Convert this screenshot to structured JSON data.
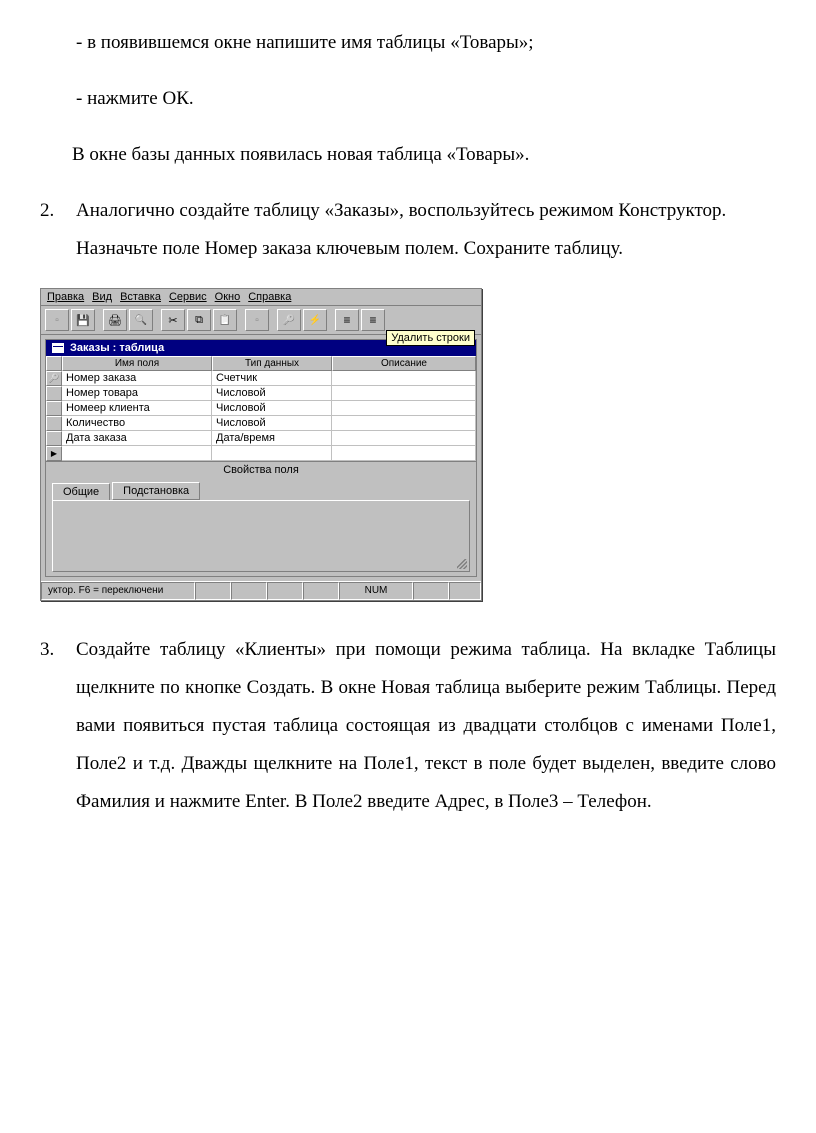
{
  "text": {
    "bullet1": "- в появившемся окне напишите имя таблицы «Товары»;",
    "bullet2": "- нажмите ОК.",
    "para_db": "В окне базы данных появилась новая таблица «Товары».",
    "item2_num": "2.",
    "item2_body": "Аналогично создайте таблицу «Заказы», воспользуйтесь режимом Конструктор.",
    "item2_body2": "Назначьте поле Номер заказа ключевым полем. Сохраните таблицу.",
    "item3_num": "3.",
    "item3_body": "Создайте таблицу «Клиенты» при помощи режима таблица. На вкладке Таблицы щелкните по кнопке Создать. В окне Новая таблица выберите режим Таблицы. Перед вами появиться пустая таблица состоящая из двадцати столбцов с именами Поле1, Поле2 и т.д. Дважды щелкните на Поле1, текст в поле будет выделен, введите слово Фамилия и нажмите Enter. В Поле2 введите Адрес, в Поле3 – Телефон."
  },
  "access": {
    "menu": [
      "Правка",
      "Вид",
      "Вставка",
      "Сервис",
      "Окно",
      "Справка"
    ],
    "tooltip": "Удалить строки",
    "window_title": "Заказы : таблица",
    "grid_headers": [
      "",
      "Имя поля",
      "Тип данных",
      "Описание"
    ],
    "rows": [
      {
        "marker": "key",
        "name": "Номер заказа",
        "type": "Счетчик",
        "desc": ""
      },
      {
        "marker": "",
        "name": "Номер товара",
        "type": "Числовой",
        "desc": ""
      },
      {
        "marker": "",
        "name": "Номеер клиента",
        "type": "Числовой",
        "desc": ""
      },
      {
        "marker": "",
        "name": "Количество",
        "type": "Числовой",
        "desc": ""
      },
      {
        "marker": "",
        "name": "Дата заказа",
        "type": "Дата/время",
        "desc": ""
      },
      {
        "marker": "caret",
        "name": "",
        "type": "",
        "desc": ""
      }
    ],
    "props_label": "Свойства поля",
    "tabs": {
      "general": "Общие",
      "lookup": "Подстановка"
    },
    "status_left": "уктор.  F6 = переключени",
    "status_num": "NUM"
  }
}
